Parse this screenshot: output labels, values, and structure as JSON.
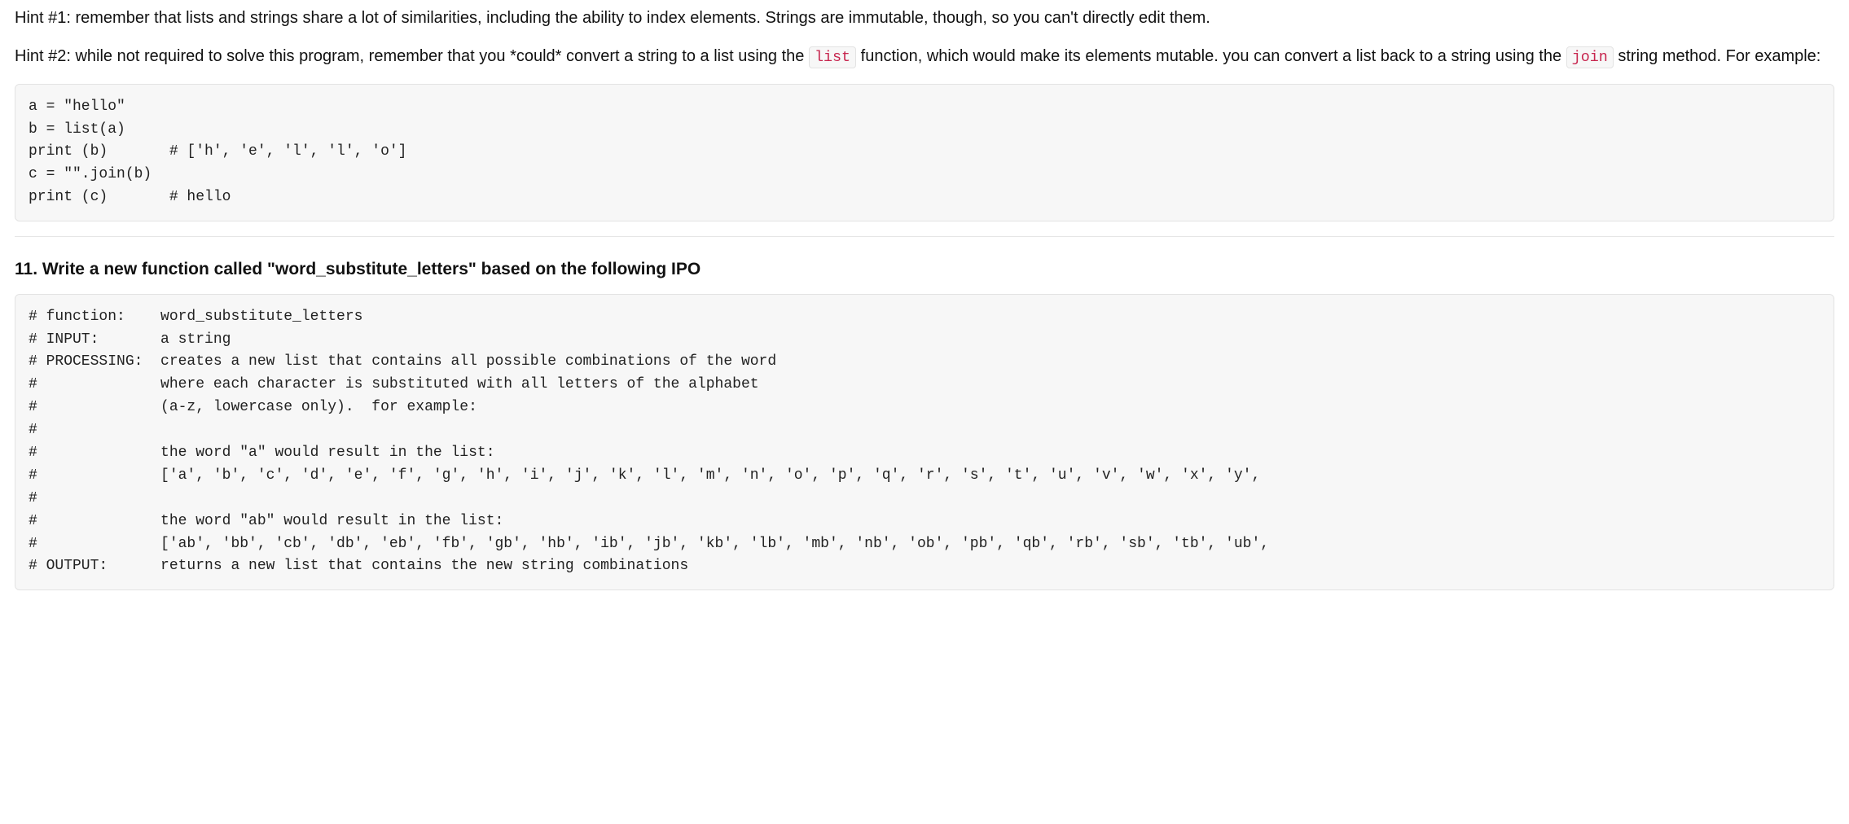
{
  "hints": {
    "hint1": "Hint #1: remember that lists and strings share a lot of similarities, including the ability to index elements. Strings are immutable, though, so you can't directly edit them.",
    "hint2_part1": "Hint #2: while not required to solve this program, remember that you *could* convert a string to a list using the ",
    "hint2_code1": "list",
    "hint2_part2": " function, which would make its elements mutable. you can convert a list back to a string using the ",
    "hint2_code2": "join",
    "hint2_part3": " string method. For example:"
  },
  "code1": "a = \"hello\"\nb = list(a)\nprint (b)       # ['h', 'e', 'l', 'l', 'o']\nc = \"\".join(b)\nprint (c)       # hello",
  "question_title": "11. Write a new function called \"word_substitute_letters\" based on the following IPO",
  "code2": "# function:    word_substitute_letters\n# INPUT:       a string\n# PROCESSING:  creates a new list that contains all possible combinations of the word\n#              where each character is substituted with all letters of the alphabet\n#              (a-z, lowercase only).  for example:\n#\n#              the word \"a\" would result in the list:\n#              ['a', 'b', 'c', 'd', 'e', 'f', 'g', 'h', 'i', 'j', 'k', 'l', 'm', 'n', 'o', 'p', 'q', 'r', 's', 't', 'u', 'v', 'w', 'x', 'y',\n#\n#              the word \"ab\" would result in the list:\n#              ['ab', 'bb', 'cb', 'db', 'eb', 'fb', 'gb', 'hb', 'ib', 'jb', 'kb', 'lb', 'mb', 'nb', 'ob', 'pb', 'qb', 'rb', 'sb', 'tb', 'ub',\n# OUTPUT:      returns a new list that contains the new string combinations"
}
